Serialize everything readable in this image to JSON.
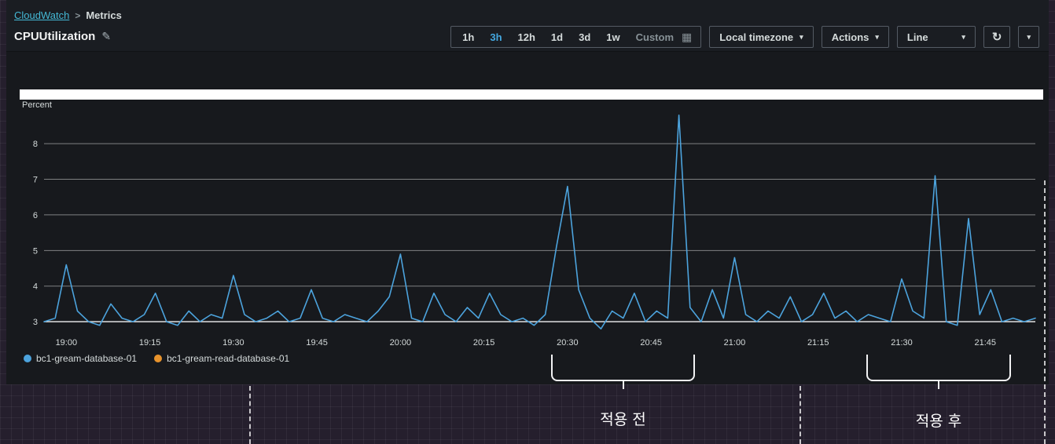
{
  "breadcrumb": {
    "root": "CloudWatch",
    "separator": ">",
    "current": "Metrics"
  },
  "header": {
    "title": "CPUUtilization"
  },
  "icons": {
    "edit": "✎",
    "calendar": "▦",
    "caret": "▾",
    "refresh": "↻"
  },
  "toolbar": {
    "ranges": [
      "1h",
      "3h",
      "12h",
      "1d",
      "3d",
      "1w",
      "Custom"
    ],
    "selected_range": "3h",
    "timezone_label": "Local timezone",
    "actions_label": "Actions",
    "chart_type_label": "Line"
  },
  "colors": {
    "accent_blue": "#44a8e0",
    "link_blue": "#44b9d6",
    "series_blue": "#4ca3dd",
    "series_orange": "#e8932c"
  },
  "annotations": {
    "before": "적용 전",
    "after": "적용 후"
  },
  "chart_data": {
    "type": "line",
    "title": "CPUUtilization",
    "xlabel": "",
    "ylabel": "Percent",
    "grid": true,
    "legend_position": "bottom-left",
    "xlim": [
      "18:56",
      "21:54"
    ],
    "ylim": [
      2.65,
      8.95
    ],
    "x_ticks": [
      "19:00",
      "19:15",
      "19:30",
      "19:45",
      "20:00",
      "20:15",
      "20:30",
      "20:45",
      "21:00",
      "21:15",
      "21:30",
      "21:45"
    ],
    "y_ticks": [
      3,
      4,
      5,
      6,
      7,
      8
    ],
    "series": [
      {
        "name": "bc1-gream-database-01",
        "color": "#4ca3dd",
        "points": [
          [
            "18:56",
            3.0
          ],
          [
            "18:58",
            3.1
          ],
          [
            "19:00",
            4.6
          ],
          [
            "19:02",
            3.3
          ],
          [
            "19:04",
            3.0
          ],
          [
            "19:06",
            2.9
          ],
          [
            "19:08",
            3.5
          ],
          [
            "19:10",
            3.1
          ],
          [
            "19:12",
            3.0
          ],
          [
            "19:14",
            3.2
          ],
          [
            "19:16",
            3.8
          ],
          [
            "19:18",
            3.0
          ],
          [
            "19:20",
            2.9
          ],
          [
            "19:22",
            3.3
          ],
          [
            "19:24",
            3.0
          ],
          [
            "19:26",
            3.2
          ],
          [
            "19:28",
            3.1
          ],
          [
            "19:30",
            4.3
          ],
          [
            "19:32",
            3.2
          ],
          [
            "19:34",
            3.0
          ],
          [
            "19:36",
            3.1
          ],
          [
            "19:38",
            3.3
          ],
          [
            "19:40",
            3.0
          ],
          [
            "19:42",
            3.1
          ],
          [
            "19:44",
            3.9
          ],
          [
            "19:46",
            3.1
          ],
          [
            "19:48",
            3.0
          ],
          [
            "19:50",
            3.2
          ],
          [
            "19:52",
            3.1
          ],
          [
            "19:54",
            3.0
          ],
          [
            "19:56",
            3.3
          ],
          [
            "19:58",
            3.7
          ],
          [
            "20:00",
            4.9
          ],
          [
            "20:02",
            3.1
          ],
          [
            "20:04",
            3.0
          ],
          [
            "20:06",
            3.8
          ],
          [
            "20:08",
            3.2
          ],
          [
            "20:10",
            3.0
          ],
          [
            "20:12",
            3.4
          ],
          [
            "20:14",
            3.1
          ],
          [
            "20:16",
            3.8
          ],
          [
            "20:18",
            3.2
          ],
          [
            "20:20",
            3.0
          ],
          [
            "20:22",
            3.1
          ],
          [
            "20:24",
            2.9
          ],
          [
            "20:26",
            3.2
          ],
          [
            "20:28",
            5.1
          ],
          [
            "20:30",
            6.8
          ],
          [
            "20:32",
            3.9
          ],
          [
            "20:34",
            3.1
          ],
          [
            "20:36",
            2.8
          ],
          [
            "20:38",
            3.3
          ],
          [
            "20:40",
            3.1
          ],
          [
            "20:42",
            3.8
          ],
          [
            "20:44",
            3.0
          ],
          [
            "20:46",
            3.3
          ],
          [
            "20:48",
            3.1
          ],
          [
            "20:50",
            8.8
          ],
          [
            "20:52",
            3.4
          ],
          [
            "20:54",
            3.0
          ],
          [
            "20:56",
            3.9
          ],
          [
            "20:58",
            3.1
          ],
          [
            "21:00",
            4.8
          ],
          [
            "21:02",
            3.2
          ],
          [
            "21:04",
            3.0
          ],
          [
            "21:06",
            3.3
          ],
          [
            "21:08",
            3.1
          ],
          [
            "21:10",
            3.7
          ],
          [
            "21:12",
            3.0
          ],
          [
            "21:14",
            3.2
          ],
          [
            "21:16",
            3.8
          ],
          [
            "21:18",
            3.1
          ],
          [
            "21:20",
            3.3
          ],
          [
            "21:22",
            3.0
          ],
          [
            "21:24",
            3.2
          ],
          [
            "21:26",
            3.1
          ],
          [
            "21:28",
            3.0
          ],
          [
            "21:30",
            4.2
          ],
          [
            "21:32",
            3.3
          ],
          [
            "21:34",
            3.1
          ],
          [
            "21:36",
            7.1
          ],
          [
            "21:38",
            3.0
          ],
          [
            "21:40",
            2.9
          ],
          [
            "21:42",
            5.9
          ],
          [
            "21:44",
            3.2
          ],
          [
            "21:46",
            3.9
          ],
          [
            "21:48",
            3.0
          ],
          [
            "21:50",
            3.1
          ],
          [
            "21:52",
            3.0
          ],
          [
            "21:54",
            3.1
          ]
        ]
      },
      {
        "name": "bc1-gream-read-database-01",
        "color": "#e8932c",
        "points": []
      }
    ]
  }
}
